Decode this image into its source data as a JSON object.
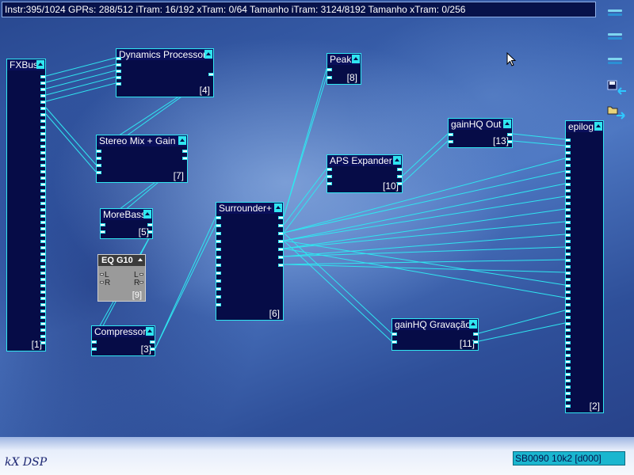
{
  "window": {
    "status_line": "Instr:395/1024 GPRs: 288/512 iTram: 16/192 xTram: 0/64 Tamanho iTram: 3124/8192 Tamanho xTram: 0/256",
    "logo": "kX DSP",
    "bottom_status": "SB0090 10k2 [d000]"
  },
  "colors": {
    "accent": "#2fe6f0",
    "plugin_bg": "#060c47",
    "cable": "#2fe6f0"
  },
  "toolbar": {
    "buttons": [
      {
        "icon": "menu-bars-icon"
      },
      {
        "icon": "menu-bars-icon"
      },
      {
        "icon": "menu-bars-icon"
      },
      {
        "icon": "save-icon"
      },
      {
        "icon": "open-folder-icon"
      }
    ]
  },
  "plugins": {
    "fxbus": {
      "title": "FXBus",
      "index": "[1]"
    },
    "dynamics": {
      "title": "Dynamics Processor",
      "index": "[4]"
    },
    "stereomix": {
      "title": "Stereo Mix + Gain",
      "index": "[7]"
    },
    "morebass": {
      "title": "MoreBass",
      "index": "[5]"
    },
    "eqg10": {
      "title": "EQ G10",
      "index": "[9]",
      "in_l": "L",
      "in_r": "R",
      "out_l": "L",
      "out_r": "R"
    },
    "compressor": {
      "title": "Compressor",
      "index": "[3]"
    },
    "surrounder": {
      "title": "Surrounder+",
      "index": "[6]"
    },
    "peak": {
      "title": "Peak",
      "index": "[8]"
    },
    "apsexpander": {
      "title": "APS Expander",
      "index": "[10]"
    },
    "gainhqout": {
      "title": "gainHQ Out",
      "index": "[13]"
    },
    "gainhqgrav": {
      "title": "gainHQ Gravação",
      "index": "[11]"
    },
    "epilog": {
      "title": "epilog",
      "index": "[2]"
    }
  }
}
